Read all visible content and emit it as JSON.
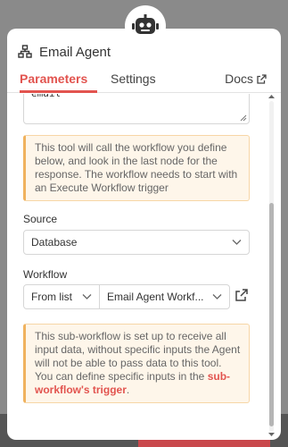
{
  "header": {
    "title": "Email Agent"
  },
  "tabs": [
    {
      "label": "Parameters",
      "active": true
    },
    {
      "label": "Settings",
      "active": false
    }
  ],
  "docs_label": "Docs",
  "description_field": {
    "value": "email"
  },
  "notice_top": "This tool will call the workflow you define below, and look in the last node for the response. The workflow needs to start with an Execute Workflow trigger",
  "source": {
    "label": "Source",
    "value": "Database"
  },
  "workflow": {
    "label": "Workflow",
    "mode": "From list",
    "value": "Email Agent Workf..."
  },
  "notice_bottom": {
    "text": "This sub-workflow is set up to receive all input data, without specific inputs the Agent will not be able to pass data to this tool. You can define specific inputs in the ",
    "link": "sub-workflow's trigger",
    "end": "."
  },
  "colors": {
    "accent": "#e2544f",
    "notice_bg": "#fef6ea",
    "notice_border": "#f0b25e"
  }
}
